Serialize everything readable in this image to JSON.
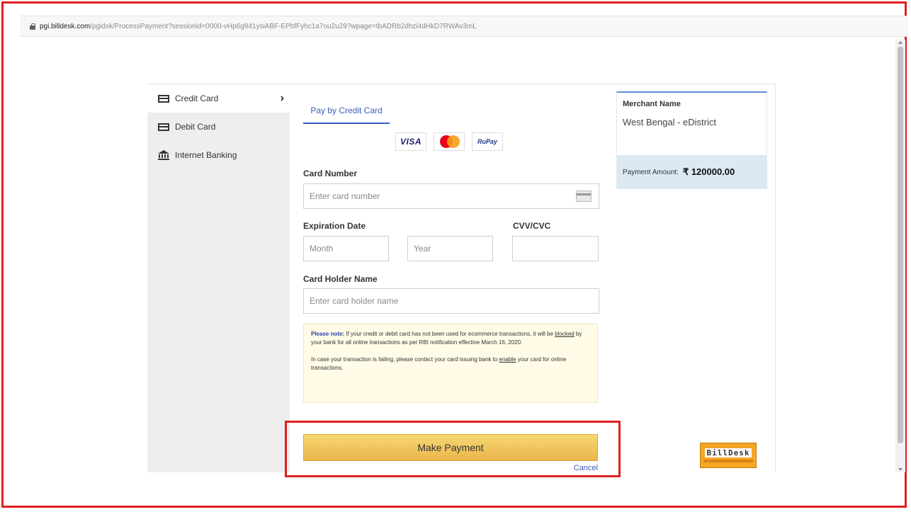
{
  "browser": {
    "url_domain": "pgi.billdesk.com",
    "url_path": "/pgidsk/ProcessPayment?sessionid=0000-vHp6g941ysiABF-EPbfFyhc1a7ou2u29?wpage=tbADRb2dhzi4dHkD7RWAv3mL"
  },
  "nav": {
    "items": [
      {
        "label": "Credit Card",
        "icon": "credit-card-icon"
      },
      {
        "label": "Debit Card",
        "icon": "debit-card-icon"
      },
      {
        "label": "Internet Banking",
        "icon": "bank-icon"
      }
    ],
    "active_chevron": "›"
  },
  "form": {
    "tab_label": "Pay by Credit Card",
    "logos": [
      "VISA",
      "Mastercard",
      "RuPay"
    ],
    "card_number_label": "Card Number",
    "card_number_placeholder": "Enter card number",
    "expiry_label": "Expiration Date",
    "month_placeholder": "Month",
    "year_placeholder": "Year",
    "cvv_label": "CVV/CVC",
    "holder_label": "Card Holder Name",
    "holder_placeholder": "Enter card holder name",
    "note": {
      "prefix": "Please note:",
      "p1a": " If your credit or debit card has not been used for ecommerce transactions, it will be ",
      "p1_link": "blocked",
      "p1b": " by your bank for all online transactions as per RBI notification effective March 16, 2020.",
      "p2a": "In case your transaction is failing, please contact your card issuing bank to ",
      "p2_link": "enable",
      "p2b": " your card for online transactions."
    },
    "pay_button": "Make Payment",
    "cancel": "Cancel"
  },
  "merchant": {
    "label": "Merchant Name",
    "name": "West Bengal - eDistrict",
    "amount_label": "Payment Amount:",
    "amount": "₹ 120000.00"
  },
  "brand": {
    "name": "BillDesk"
  },
  "colors": {
    "highlight": "#e02020",
    "accent": "#3a5bbf",
    "button": "#f0c45a"
  }
}
